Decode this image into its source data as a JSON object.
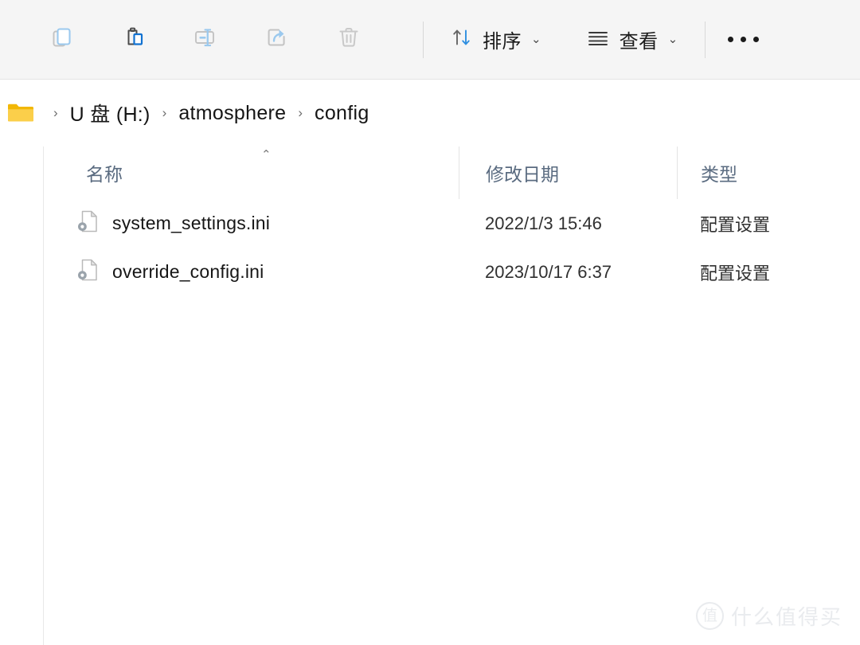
{
  "toolbar": {
    "buttons": [
      {
        "name": "copy",
        "label": "复制",
        "icon": "copy-icon"
      },
      {
        "name": "paste",
        "label": "粘贴",
        "icon": "paste-icon"
      },
      {
        "name": "rename",
        "label": "重命名",
        "icon": "rename-icon"
      },
      {
        "name": "share",
        "label": "共享",
        "icon": "share-icon"
      },
      {
        "name": "delete",
        "label": "删除",
        "icon": "trash-icon"
      }
    ],
    "sort": {
      "label": "排序",
      "icon": "sort-icon",
      "chevron": "⌄"
    },
    "view": {
      "label": "查看",
      "icon": "view-list-icon",
      "chevron": "⌄"
    },
    "overflow": {
      "label": "查看更多",
      "icon": "ellipsis-icon"
    }
  },
  "breadcrumb": {
    "folder_icon": "folder-icon",
    "separator": "›",
    "items": [
      {
        "label": "U 盘 (H:)"
      },
      {
        "label": "atmosphere"
      },
      {
        "label": "config"
      }
    ]
  },
  "columns": {
    "name": "名称",
    "date_modified": "修改日期",
    "type": "类型",
    "sort_caret": "⌃"
  },
  "files": [
    {
      "name": "system_settings.ini",
      "date_modified": "2022/1/3 15:46",
      "type": "配置设置",
      "icon": "ini-file-icon"
    },
    {
      "name": "override_config.ini",
      "date_modified": "2023/10/17 6:37",
      "type": "配置设置",
      "icon": "ini-file-icon"
    }
  ],
  "watermark": {
    "logo_char": "值",
    "text": "什么值得买"
  },
  "colors": {
    "toolbar_bg": "#f5f5f5",
    "accent_blue": "#0f6cbd",
    "icon_blue": "#9bc9ee",
    "folder_yellow": "#f7c948",
    "header_text": "#5a6b80",
    "body_text": "#161616"
  }
}
